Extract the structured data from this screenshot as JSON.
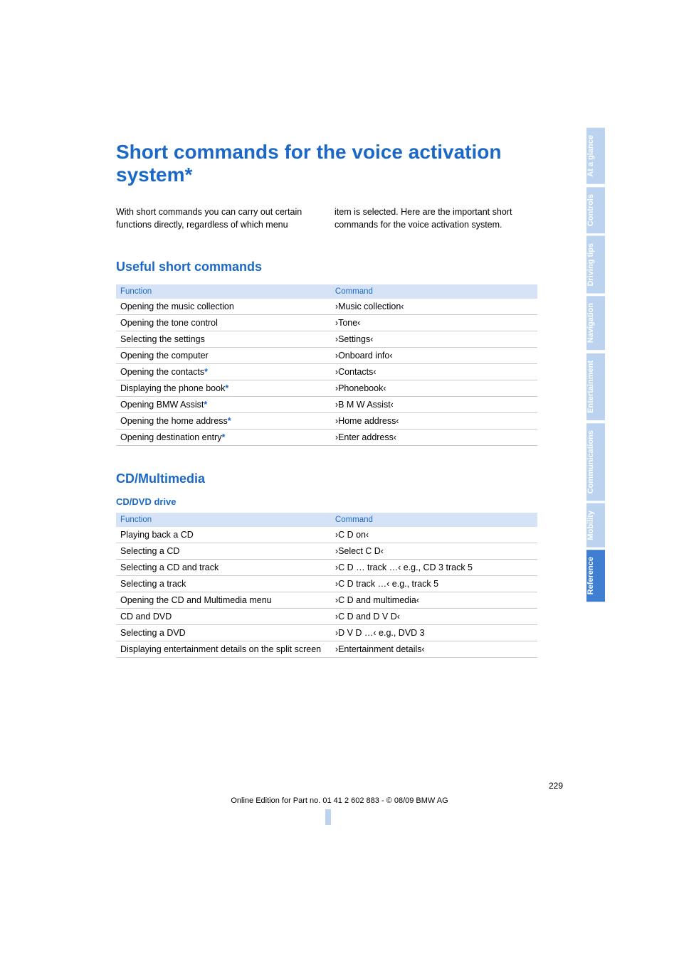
{
  "title": "Short commands for the voice activation system*",
  "intro": {
    "left": "With short commands you can carry out certain functions directly, regardless of which menu",
    "right": "item is selected. Here are the important short commands for the voice activation system."
  },
  "headers": {
    "function": "Function",
    "command": "Command"
  },
  "section_useful": {
    "heading": "Useful short commands",
    "rows": [
      {
        "fn": "Opening the music collection",
        "star": false,
        "cmd": "›Music collection‹"
      },
      {
        "fn": "Opening the tone control",
        "star": false,
        "cmd": "›Tone‹"
      },
      {
        "fn": "Selecting the settings",
        "star": false,
        "cmd": "›Settings‹"
      },
      {
        "fn": "Opening the computer",
        "star": false,
        "cmd": "›Onboard info‹"
      },
      {
        "fn": "Opening the contacts",
        "star": true,
        "cmd": "›Contacts‹"
      },
      {
        "fn": "Displaying the phone book",
        "star": true,
        "cmd": "›Phonebook‹"
      },
      {
        "fn": "Opening BMW Assist",
        "star": true,
        "cmd": "›B M W Assist‹"
      },
      {
        "fn": "Opening the home address",
        "star": true,
        "cmd": "›Home address‹"
      },
      {
        "fn": "Opening destination entry",
        "star": true,
        "cmd": "›Enter address‹"
      }
    ]
  },
  "section_cd": {
    "heading": "CD/Multimedia",
    "subheading": "CD/DVD drive",
    "rows": [
      {
        "fn": "Playing back a CD",
        "cmd": "›C D on‹"
      },
      {
        "fn": "Selecting a CD",
        "cmd": "›Select C D‹"
      },
      {
        "fn": "Selecting a CD and track",
        "cmd": "›C D … track …‹ e.g., CD 3 track 5"
      },
      {
        "fn": "Selecting a track",
        "cmd": "›C D track …‹ e.g., track 5"
      },
      {
        "fn": "Opening the CD and Multimedia menu",
        "cmd": "›C D and multimedia‹"
      },
      {
        "fn": "CD and DVD",
        "cmd": "›C D and D V D‹"
      },
      {
        "fn": "Selecting a DVD",
        "cmd": "›D V D …‹ e.g., DVD 3"
      },
      {
        "fn": "Displaying entertainment details on the split screen",
        "cmd": "›Entertainment details‹"
      }
    ]
  },
  "page_number": "229",
  "footer": "Online Edition for Part no. 01 41 2 602 883 - © 08/09 BMW AG",
  "tabs": [
    {
      "label": "At a glance",
      "active": false
    },
    {
      "label": "Controls",
      "active": false
    },
    {
      "label": "Driving tips",
      "active": false
    },
    {
      "label": "Navigation",
      "active": false
    },
    {
      "label": "Entertainment",
      "active": false
    },
    {
      "label": "Communications",
      "active": false
    },
    {
      "label": "Mobility",
      "active": false
    },
    {
      "label": "Reference",
      "active": true
    }
  ]
}
